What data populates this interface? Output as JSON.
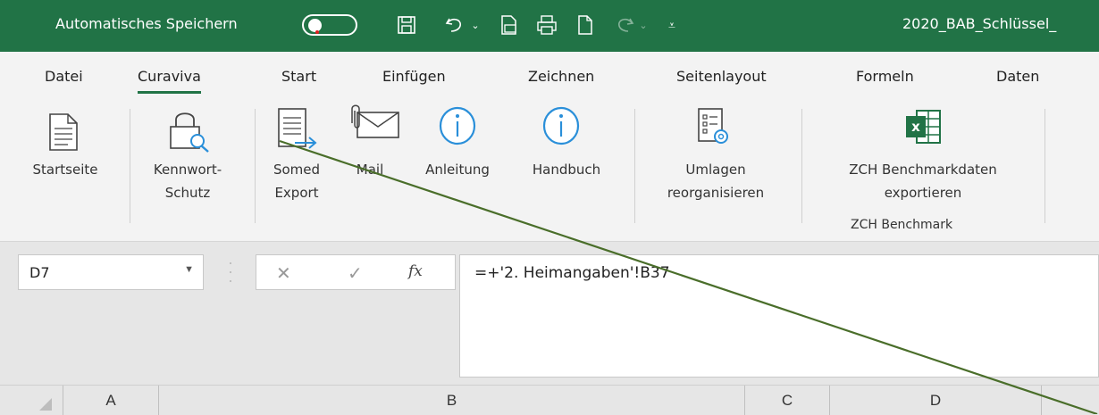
{
  "titlebar": {
    "autosave_label": "Automatisches Speichern",
    "filename": "2020_BAB_Schlüssel_",
    "qat_icons": [
      "save-icon",
      "undo-icon",
      "export-pdf-icon",
      "print-icon",
      "new-document-icon",
      "redo-icon",
      "customize-icon"
    ]
  },
  "tabs": [
    "Datei",
    "Curaviva",
    "Start",
    "Einfügen",
    "Zeichnen",
    "Seitenlayout",
    "Formeln",
    "Daten"
  ],
  "active_tab": "Curaviva",
  "ribbon": {
    "startseite": "Startseite",
    "kennwort_1": "Kennwort-",
    "kennwort_2": "Schutz",
    "somed_1": "Somed",
    "somed_2": "Export",
    "mail": "Mail",
    "anleitung": "Anleitung",
    "handbuch": "Handbuch",
    "umlagen_1": "Umlagen",
    "umlagen_2": "reorganisieren",
    "zch_1": "ZCH Benchmarkdaten",
    "zch_2": "exportieren",
    "zch_group": "ZCH Benchmark"
  },
  "formula_bar": {
    "name_box": "D7",
    "cancel": "✕",
    "enter": "✓",
    "fx": "fx",
    "formula": "=+'2. Heimangaben'!B37"
  },
  "columns": [
    "A",
    "B",
    "C",
    "D"
  ],
  "colors": {
    "title_bar": "#217346",
    "accent": "#217346",
    "info_icon": "#2a8fd9",
    "annotation_line": "#4a6e2a"
  }
}
